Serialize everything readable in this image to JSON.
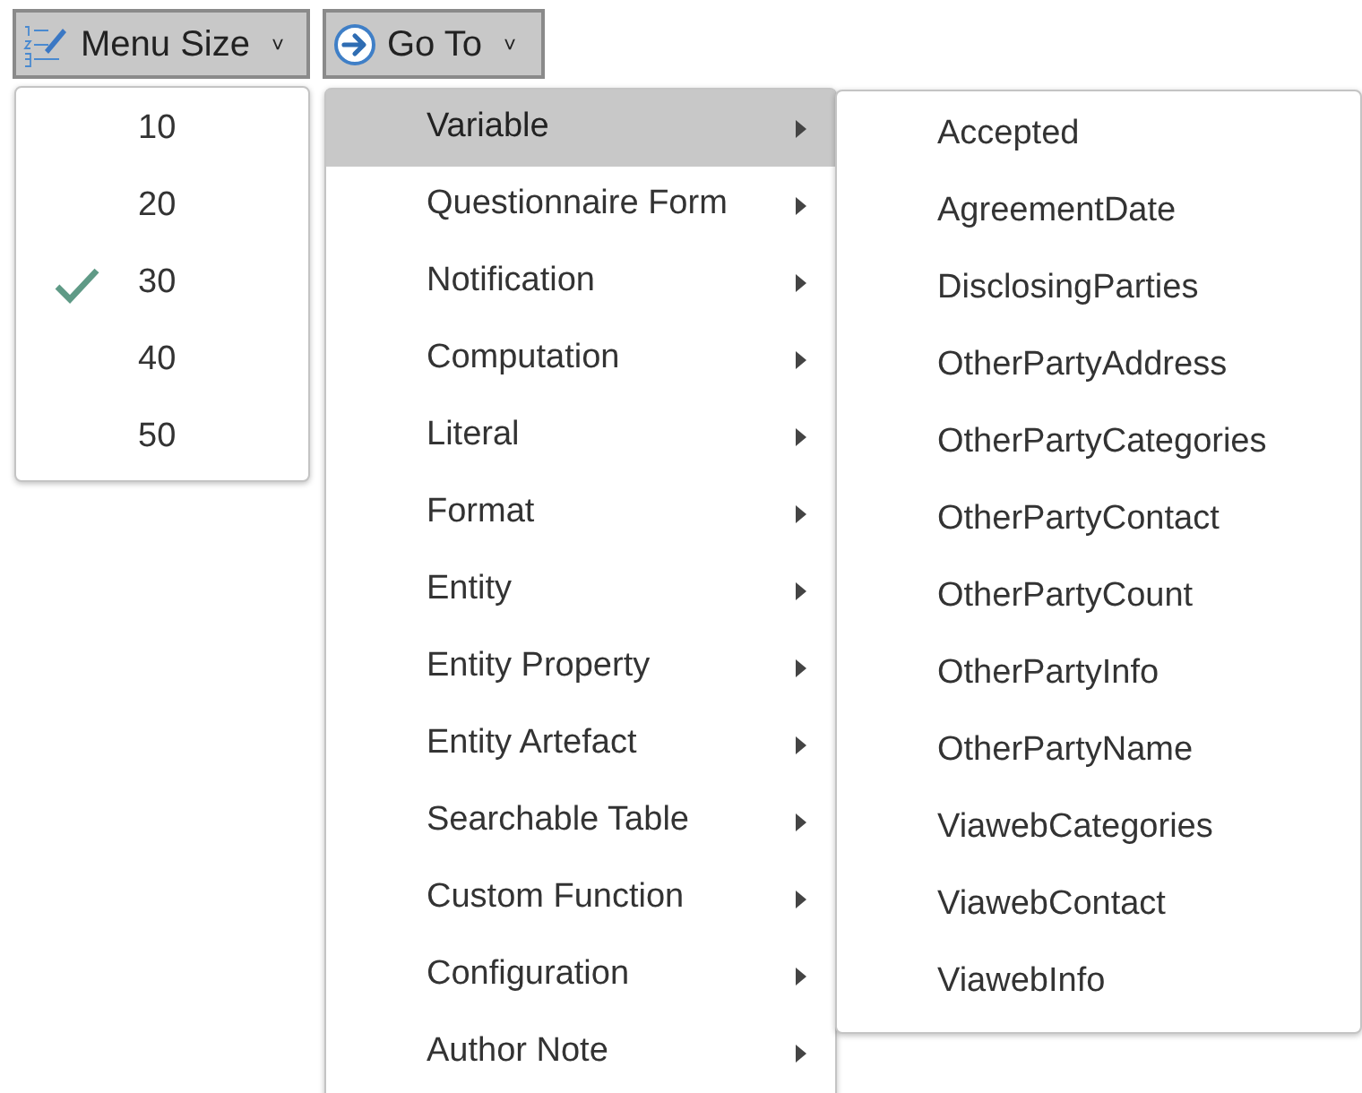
{
  "toolbar": [
    {
      "kind": "list",
      "label": "Menu Size",
      "caret": "˅"
    },
    {
      "kind": "goto",
      "label": "Go To",
      "caret": "˅"
    }
  ],
  "menu_size": {
    "items": [
      {
        "label": "10",
        "checked": false
      },
      {
        "label": "20",
        "checked": false
      },
      {
        "label": "30",
        "checked": true
      },
      {
        "label": "40",
        "checked": false
      },
      {
        "label": "50",
        "checked": false
      }
    ]
  },
  "go_to": {
    "items": [
      {
        "label": "Variable",
        "selected": true
      },
      {
        "label": "Questionnaire Form",
        "selected": false
      },
      {
        "label": "Notification",
        "selected": false
      },
      {
        "label": "Computation",
        "selected": false
      },
      {
        "label": "Literal",
        "selected": false
      },
      {
        "label": "Format",
        "selected": false
      },
      {
        "label": "Entity",
        "selected": false
      },
      {
        "label": "Entity Property",
        "selected": false
      },
      {
        "label": "Entity Artefact",
        "selected": false
      },
      {
        "label": "Searchable Table",
        "selected": false
      },
      {
        "label": "Custom Function",
        "selected": false
      },
      {
        "label": "Configuration",
        "selected": false
      },
      {
        "label": "Author Note",
        "selected": false
      }
    ]
  },
  "variable_submenu": {
    "items": [
      "Accepted",
      "AgreementDate",
      "DisclosingParties",
      "OtherPartyAddress",
      "OtherPartyCategories",
      "OtherPartyContact",
      "OtherPartyCount",
      "OtherPartyInfo",
      "OtherPartyName",
      "ViawebCategories",
      "ViawebContact",
      "ViawebInfo"
    ]
  }
}
